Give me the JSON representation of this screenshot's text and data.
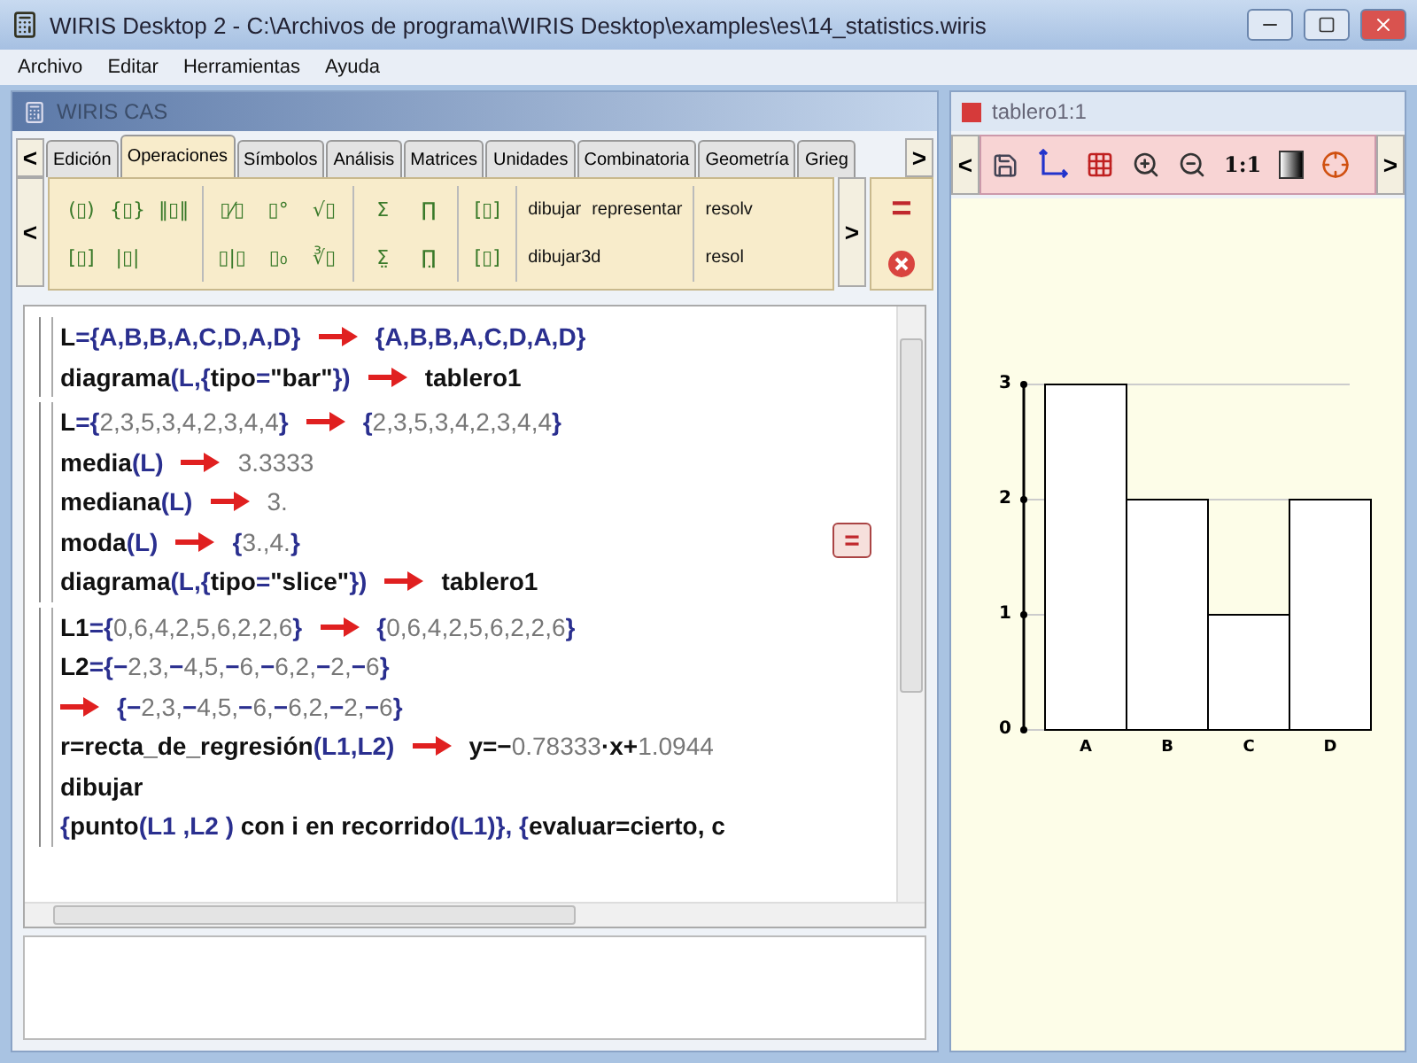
{
  "window": {
    "title": "WIRIS Desktop 2 - C:\\Archivos de programa\\WIRIS Desktop\\examples\\es\\14_statistics.wiris"
  },
  "menu": [
    "Archivo",
    "Editar",
    "Herramientas",
    "Ayuda"
  ],
  "cas": {
    "title": "WIRIS CAS",
    "tab_prev": "<",
    "tab_next": ">",
    "tabs": [
      {
        "label": "Edición",
        "selected": false
      },
      {
        "label": "Operaciones",
        "selected": true
      },
      {
        "label": "Símbolos",
        "selected": false
      },
      {
        "label": "Análisis",
        "selected": false
      },
      {
        "label": "Matrices",
        "selected": false
      },
      {
        "label": "Unidades",
        "selected": false
      },
      {
        "label": "Combinatoria",
        "selected": false
      },
      {
        "label": "Geometría",
        "selected": false
      },
      {
        "label": "Grieg",
        "selected": false
      }
    ],
    "toolbar_prev": "<",
    "toolbar_next": ">",
    "toolbar": [
      {
        "kind": "templates",
        "rows": [
          [
            "(▯)",
            "{▯}",
            "‖▯‖"
          ],
          [
            "[▯]",
            "|▯|"
          ]
        ]
      },
      {
        "kind": "templates",
        "rows": [
          [
            "▯⁄▯",
            "▯°",
            "√▯"
          ],
          [
            "▯|▯",
            "▯₀",
            "∛▯"
          ]
        ]
      },
      {
        "kind": "templates",
        "rows": [
          [
            "Σ",
            "∏"
          ],
          [
            "Σ̤",
            "∏̤"
          ]
        ]
      },
      {
        "kind": "templates",
        "rows": [
          [
            "[▯]"
          ],
          [
            "[▯]"
          ]
        ]
      },
      {
        "kind": "commands",
        "rows": [
          [
            "dibujar",
            "representar"
          ],
          [
            "dibujar3d"
          ]
        ]
      },
      {
        "kind": "commands",
        "rows": [
          [
            "resolv"
          ],
          [
            "resol"
          ]
        ]
      }
    ],
    "evaluate": "="
  },
  "worksheet": {
    "evaluate": "=",
    "groups": [
      {
        "lines": [
          {
            "input": [
              {
                "kind": "name",
                "text": "L"
              },
              {
                "kind": "symbol",
                "text": "={A,B,B,A,C,D,A,D}"
              }
            ],
            "output": [
              {
                "kind": "symbol",
                "text": "{A,B,B,A,C,D,A,D}"
              }
            ]
          },
          {
            "input": [
              {
                "kind": "name",
                "text": "diagrama"
              },
              {
                "kind": "symbol",
                "text": "(L,{"
              },
              {
                "kind": "name",
                "text": "tipo"
              },
              {
                "kind": "symbol",
                "text": "="
              },
              {
                "kind": "name",
                "text": "\"bar\""
              },
              {
                "kind": "symbol",
                "text": "})"
              }
            ],
            "output": [
              {
                "kind": "name",
                "text": "tablero1"
              }
            ]
          }
        ]
      },
      {
        "lines": [
          {
            "input": [
              {
                "kind": "name",
                "text": "L"
              },
              {
                "kind": "symbol",
                "text": "={"
              },
              {
                "kind": "number",
                "text": "2,3,5,3,4,2,3,4,4"
              },
              {
                "kind": "symbol",
                "text": "}"
              }
            ],
            "output": [
              {
                "kind": "symbol",
                "text": "{"
              },
              {
                "kind": "number",
                "text": "2,3,5,3,4,2,3,4,4"
              },
              {
                "kind": "symbol",
                "text": "}"
              }
            ]
          },
          {
            "input": [
              {
                "kind": "name",
                "text": "media"
              },
              {
                "kind": "symbol",
                "text": "(L)"
              }
            ],
            "output": [
              {
                "kind": "number",
                "text": "3.3333"
              }
            ]
          },
          {
            "input": [
              {
                "kind": "name",
                "text": "mediana"
              },
              {
                "kind": "symbol",
                "text": "(L)"
              }
            ],
            "output": [
              {
                "kind": "number",
                "text": "3."
              }
            ]
          },
          {
            "input": [
              {
                "kind": "name",
                "text": "moda"
              },
              {
                "kind": "symbol",
                "text": "(L)"
              }
            ],
            "output": [
              {
                "kind": "symbol",
                "text": "{"
              },
              {
                "kind": "number",
                "text": "3.,4."
              },
              {
                "kind": "symbol",
                "text": "}"
              }
            ]
          },
          {
            "input": [
              {
                "kind": "name",
                "text": "diagrama"
              },
              {
                "kind": "symbol",
                "text": "(L,{"
              },
              {
                "kind": "name",
                "text": "tipo"
              },
              {
                "kind": "symbol",
                "text": "="
              },
              {
                "kind": "name",
                "text": "\"slice\""
              },
              {
                "kind": "symbol",
                "text": "})"
              }
            ],
            "output": [
              {
                "kind": "name",
                "text": "tablero1"
              }
            ]
          }
        ]
      },
      {
        "lines": [
          {
            "input": [
              {
                "kind": "name",
                "text": "L1"
              },
              {
                "kind": "symbol",
                "text": "={"
              },
              {
                "kind": "number",
                "text": "0,6,4,2,5,6,2,2,6"
              },
              {
                "kind": "symbol",
                "text": "}"
              }
            ],
            "output": [
              {
                "kind": "symbol",
                "text": "{"
              },
              {
                "kind": "number",
                "text": "0,6,4,2,5,6,2,2,6"
              },
              {
                "kind": "symbol",
                "text": "}"
              }
            ]
          },
          {
            "input": [
              {
                "kind": "name",
                "text": "L2"
              },
              {
                "kind": "symbol",
                "text": "={−"
              },
              {
                "kind": "number",
                "text": "2,3,"
              },
              {
                "kind": "symbol",
                "text": "−"
              },
              {
                "kind": "number",
                "text": "4,5,"
              },
              {
                "kind": "symbol",
                "text": "−"
              },
              {
                "kind": "number",
                "text": "6,"
              },
              {
                "kind": "symbol",
                "text": "−"
              },
              {
                "kind": "number",
                "text": "6,2,"
              },
              {
                "kind": "symbol",
                "text": "−"
              },
              {
                "kind": "number",
                "text": "2,"
              },
              {
                "kind": "symbol",
                "text": "−"
              },
              {
                "kind": "number",
                "text": "6"
              },
              {
                "kind": "symbol",
                "text": "}"
              }
            ]
          },
          {
            "output": [
              {
                "kind": "symbol",
                "text": "{−"
              },
              {
                "kind": "number",
                "text": "2,3,"
              },
              {
                "kind": "symbol",
                "text": "−"
              },
              {
                "kind": "number",
                "text": "4,5,"
              },
              {
                "kind": "symbol",
                "text": "−"
              },
              {
                "kind": "number",
                "text": "6,"
              },
              {
                "kind": "symbol",
                "text": "−"
              },
              {
                "kind": "number",
                "text": "6,2,"
              },
              {
                "kind": "symbol",
                "text": "−"
              },
              {
                "kind": "number",
                "text": "2,"
              },
              {
                "kind": "symbol",
                "text": "−"
              },
              {
                "kind": "number",
                "text": "6"
              },
              {
                "kind": "symbol",
                "text": "}"
              }
            ]
          },
          {
            "input": [
              {
                "kind": "name",
                "text": "r=recta_de_regresión"
              },
              {
                "kind": "symbol",
                "text": "(L1,L2)"
              }
            ],
            "output": [
              {
                "kind": "name",
                "text": "y=−"
              },
              {
                "kind": "number",
                "text": "0.78333"
              },
              {
                "kind": "name",
                "text": "·x+"
              },
              {
                "kind": "number",
                "text": "1.0944"
              }
            ]
          },
          {
            "input": [
              {
                "kind": "name",
                "text": "dibujar"
              }
            ]
          },
          {
            "input": [
              {
                "kind": "symbol",
                "text": "{"
              },
              {
                "kind": "name",
                "text": "punto"
              },
              {
                "kind": "symbol",
                "text": "(L1 ,L2 ) "
              },
              {
                "kind": "name",
                "text": "con i en recorrido"
              },
              {
                "kind": "symbol",
                "text": "(L1)}, {"
              },
              {
                "kind": "name",
                "text": "evaluar=cierto, c"
              }
            ]
          }
        ]
      }
    ]
  },
  "board": {
    "title": "tablero1:1",
    "prev": "<",
    "next": ">",
    "scale_label": "1:1",
    "chart_data": {
      "type": "bar",
      "categories": [
        "A",
        "B",
        "C",
        "D"
      ],
      "values": [
        3,
        2,
        1,
        2
      ],
      "ylim": [
        0,
        3
      ],
      "yticks": [
        0,
        1,
        2,
        3
      ]
    }
  }
}
